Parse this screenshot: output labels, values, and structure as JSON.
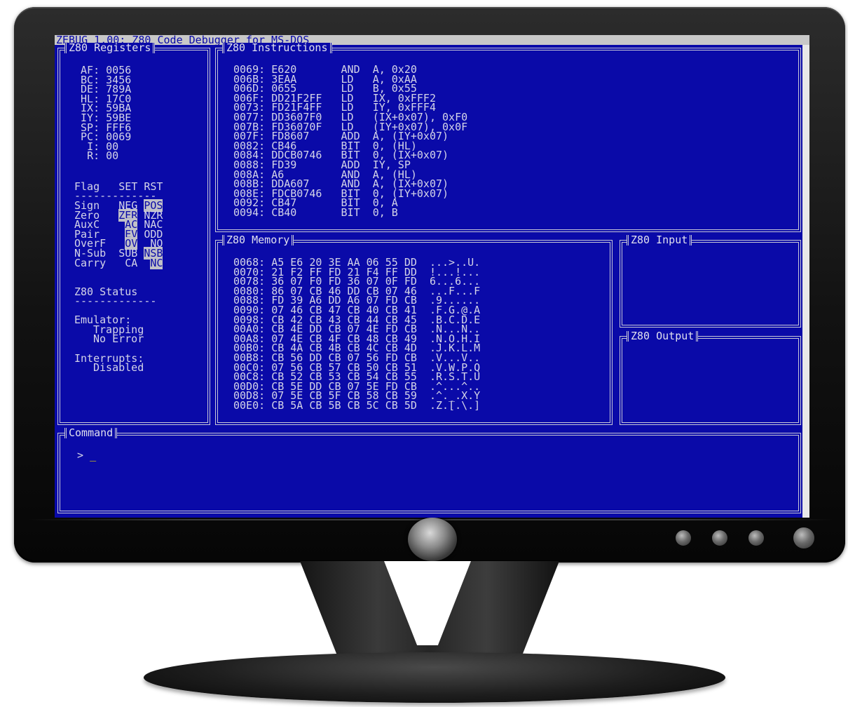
{
  "window": {
    "title": "ZEBUG 1.00: Z80 Code Debugger for MS-DOS"
  },
  "registers": {
    "title": "Z80 Registers",
    "rows": [
      {
        "name": "AF:",
        "value": "0056"
      },
      {
        "name": "BC:",
        "value": "3456"
      },
      {
        "name": "DE:",
        "value": "789A"
      },
      {
        "name": "HL:",
        "value": "17C0"
      },
      {
        "name": "IX:",
        "value": "59BA"
      },
      {
        "name": "IY:",
        "value": "59BE"
      },
      {
        "name": "SP:",
        "value": "FFF6"
      },
      {
        "name": "PC:",
        "value": "0069"
      },
      {
        "name": "I:",
        "value": "00"
      },
      {
        "name": "R:",
        "value": "00"
      }
    ]
  },
  "flags": {
    "header": {
      "flag": "Flag",
      "set": "SET",
      "rst": "RST"
    },
    "rule": "-------------",
    "rows": [
      {
        "name": "Sign",
        "set": "NEG",
        "rst": "POS",
        "active": "rst"
      },
      {
        "name": "Zero",
        "set": "ZER",
        "rst": "NZR",
        "active": "set"
      },
      {
        "name": "AuxC",
        "set": "AC",
        "rst": "NAC",
        "active": "set"
      },
      {
        "name": "Pair",
        "set": "EV",
        "rst": "ODD",
        "active": "set"
      },
      {
        "name": "OverF",
        "set": "OV",
        "rst": "NO",
        "active": "set"
      },
      {
        "name": "N-Sub",
        "set": "SUB",
        "rst": "NSB",
        "active": "rst"
      },
      {
        "name": "Carry",
        "set": "CA",
        "rst": "NC",
        "active": "rst"
      }
    ]
  },
  "status": {
    "title": "Z80 Status",
    "rule": "-------------",
    "emulator_label": "Emulator:",
    "emulator_state": "Trapping",
    "emulator_error": "No Error",
    "interrupts_label": "Interrupts:",
    "interrupts_state": "Disabled"
  },
  "instructions": {
    "title": "Z80 Instructions",
    "rows": [
      {
        "addr": "0069:",
        "bytes": "E620",
        "op": "AND",
        "args": "A, 0x20"
      },
      {
        "addr": "006B:",
        "bytes": "3EAA",
        "op": "LD",
        "args": "A, 0xAA"
      },
      {
        "addr": "006D:",
        "bytes": "0655",
        "op": "LD",
        "args": "B, 0x55"
      },
      {
        "addr": "006F:",
        "bytes": "DD21F2FF",
        "op": "LD",
        "args": "IX, 0xFFF2"
      },
      {
        "addr": "0073:",
        "bytes": "FD21F4FF",
        "op": "LD",
        "args": "IY, 0xFFF4"
      },
      {
        "addr": "0077:",
        "bytes": "DD3607F0",
        "op": "LD",
        "args": "(IX+0x07), 0xF0"
      },
      {
        "addr": "007B:",
        "bytes": "FD36070F",
        "op": "LD",
        "args": "(IY+0x07), 0x0F"
      },
      {
        "addr": "007F:",
        "bytes": "FD8607",
        "op": "ADD",
        "args": "A, (IY+0x07)"
      },
      {
        "addr": "0082:",
        "bytes": "CB46",
        "op": "BIT",
        "args": "0, (HL)"
      },
      {
        "addr": "0084:",
        "bytes": "DDCB0746",
        "op": "BIT",
        "args": "0, (IX+0x07)"
      },
      {
        "addr": "0088:",
        "bytes": "FD39",
        "op": "ADD",
        "args": "IY, SP"
      },
      {
        "addr": "008A:",
        "bytes": "A6",
        "op": "AND",
        "args": "A, (HL)"
      },
      {
        "addr": "008B:",
        "bytes": "DDA607",
        "op": "AND",
        "args": "A, (IX+0x07)"
      },
      {
        "addr": "008E:",
        "bytes": "FDCB0746",
        "op": "BIT",
        "args": "0, (IY+0x07)"
      },
      {
        "addr": "0092:",
        "bytes": "CB47",
        "op": "BIT",
        "args": "0, A"
      },
      {
        "addr": "0094:",
        "bytes": "CB40",
        "op": "BIT",
        "args": "0, B"
      }
    ]
  },
  "memory": {
    "title": "Z80 Memory",
    "rows": [
      {
        "addr": "0068:",
        "bytes": "A5 E6 20 3E AA 06 55 DD",
        "ascii": "...>..U."
      },
      {
        "addr": "0070:",
        "bytes": "21 F2 FF FD 21 F4 FF DD",
        "ascii": "!...!..."
      },
      {
        "addr": "0078:",
        "bytes": "36 07 F0 FD 36 07 0F FD",
        "ascii": "6...6..."
      },
      {
        "addr": "0080:",
        "bytes": "86 07 CB 46 DD CB 07 46",
        "ascii": "...F...F"
      },
      {
        "addr": "0088:",
        "bytes": "FD 39 A6 DD A6 07 FD CB",
        "ascii": ".9......"
      },
      {
        "addr": "0090:",
        "bytes": "07 46 CB 47 CB 40 CB 41",
        "ascii": ".F.G.@.A"
      },
      {
        "addr": "0098:",
        "bytes": "CB 42 CB 43 CB 44 CB 45",
        "ascii": ".B.C.D.E"
      },
      {
        "addr": "00A0:",
        "bytes": "CB 4E DD CB 07 4E FD CB",
        "ascii": ".N...N.."
      },
      {
        "addr": "00A8:",
        "bytes": "07 4E CB 4F CB 48 CB 49",
        "ascii": ".N.O.H.I"
      },
      {
        "addr": "00B0:",
        "bytes": "CB 4A CB 4B CB 4C CB 4D",
        "ascii": ".J.K.L.M"
      },
      {
        "addr": "00B8:",
        "bytes": "CB 56 DD CB 07 56 FD CB",
        "ascii": ".V...V.."
      },
      {
        "addr": "00C0:",
        "bytes": "07 56 CB 57 CB 50 CB 51",
        "ascii": ".V.W.P.Q"
      },
      {
        "addr": "00C8:",
        "bytes": "CB 52 CB 53 CB 54 CB 55",
        "ascii": ".R.S.T.U"
      },
      {
        "addr": "00D0:",
        "bytes": "CB 5E DD CB 07 5E FD CB",
        "ascii": ".^...^.."
      },
      {
        "addr": "00D8:",
        "bytes": "07 5E CB 5F CB 58 CB 59",
        "ascii": ".^._.X.Y"
      },
      {
        "addr": "00E0:",
        "bytes": "CB 5A CB 5B CB 5C CB 5D",
        "ascii": ".Z.[.\\.]"
      }
    ]
  },
  "input": {
    "title": "Z80 Input"
  },
  "output": {
    "title": "Z80 Output"
  },
  "command": {
    "title": "Command",
    "prompt": ">",
    "cursor": "_"
  },
  "colors": {
    "screen_bg": "#0a0aa8",
    "text": "#d4d4e8",
    "highlight_bg": "#c0c0c8",
    "cursor": "#f0e000",
    "bezel": "#141414"
  }
}
